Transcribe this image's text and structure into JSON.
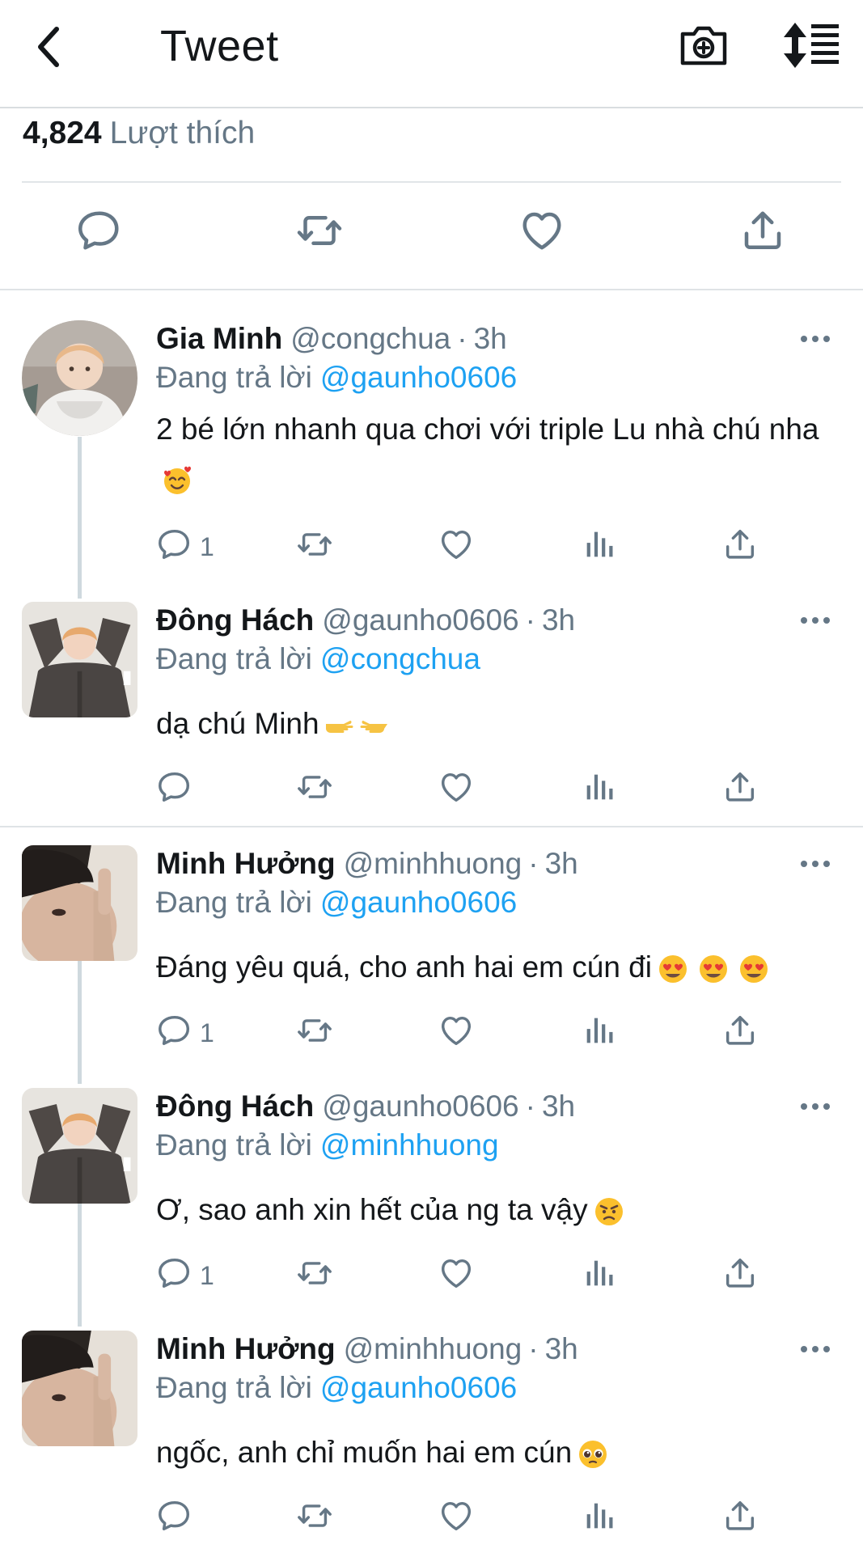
{
  "header": {
    "title": "Tweet",
    "back_icon": "chevron-left-icon",
    "camera_icon": "camera-plus-icon",
    "sort_icon": "sort-list-icon"
  },
  "tweet": {
    "likes_count": "4,824",
    "likes_label": "Lượt thích"
  },
  "main_actions": [
    "reply-icon",
    "retweet-icon",
    "like-icon",
    "share-icon"
  ],
  "colors": {
    "link": "#1da1f2",
    "muted": "#657786",
    "text": "#14171a",
    "divider": "#e1e5e8"
  },
  "replying_label": "Đang trả lời",
  "replies": [
    {
      "name": "Gia Minh",
      "handle": "@congchua",
      "dot": "·",
      "time": "3h",
      "to": "@gaunho0606",
      "text": "2 bé lớn nhanh qua chơi với triple Lu nhà chú nha",
      "emoji": "smiling-face-with-hearts",
      "reply_count": "1"
    },
    {
      "name": "Đông Hách",
      "handle": "@gaunho0606",
      "dot": "·",
      "time": "3h",
      "to": "@congchua",
      "text": "dạ chú Minh",
      "emoji": "pointing-hands",
      "reply_count": ""
    },
    {
      "name": "Minh Hưởng",
      "handle": "@minhhuong",
      "dot": "·",
      "time": "3h",
      "to": "@gaunho0606",
      "text": "Đáng yêu quá, cho anh hai em cún đi",
      "emoji": "heart-eyes-x3",
      "reply_count": "1"
    },
    {
      "name": "Đông Hách",
      "handle": "@gaunho0606",
      "dot": "·",
      "time": "3h",
      "to": "@minhhuong",
      "text": "Ơ, sao anh xin hết của ng ta vậy",
      "emoji": "angry-face",
      "reply_count": "1"
    },
    {
      "name": "Minh Hưởng",
      "handle": "@minhhuong",
      "dot": "·",
      "time": "3h",
      "to": "@gaunho0606",
      "text": "ngốc, anh chỉ muốn hai em cún",
      "emoji": "pleading-face",
      "reply_count": ""
    }
  ]
}
